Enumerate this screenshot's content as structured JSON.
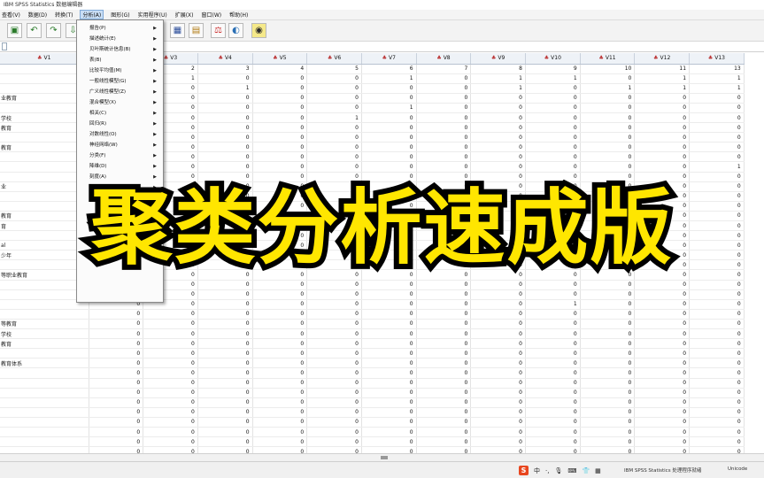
{
  "window": {
    "title": "IBM SPSS Statistics 数据编辑器"
  },
  "menubar": {
    "items": [
      "查看(V)",
      "数据(D)",
      "转换(T)",
      "分析(A)",
      "图形(G)",
      "实用程序(U)",
      "扩展(X)",
      "窗口(W)",
      "帮助(H)"
    ],
    "active": "分析(A)"
  },
  "analyze_menu": {
    "items": [
      {
        "label": "报告(P)",
        "submenu": true
      },
      {
        "label": "描述统计(E)",
        "submenu": true
      },
      {
        "label": "贝叶斯统计信息(B)",
        "submenu": true
      },
      {
        "label": "表(B)",
        "submenu": true
      },
      {
        "label": "比较平均值(M)",
        "submenu": true
      },
      {
        "label": "一般线性模型(G)",
        "submenu": true
      },
      {
        "label": "广义线性模型(Z)",
        "submenu": true
      },
      {
        "label": "混合模型(X)",
        "submenu": true
      },
      {
        "label": "相关(C)",
        "submenu": true
      },
      {
        "label": "回归(R)",
        "submenu": true
      },
      {
        "label": "对数线性(O)",
        "submenu": true
      },
      {
        "label": "神经网络(W)",
        "submenu": true
      },
      {
        "label": "分类(F)",
        "submenu": true
      },
      {
        "label": "降维(D)",
        "submenu": true
      },
      {
        "label": "刻度(A)",
        "submenu": true
      },
      {
        "label": "直销(K)",
        "submenu": true
      }
    ]
  },
  "grid": {
    "columns": [
      "V1",
      "V2",
      "V3",
      "V4",
      "V5",
      "V6",
      "V7",
      "V8",
      "V9",
      "V10",
      "V11",
      "V12",
      "V13"
    ],
    "rows": [
      [
        "",
        "",
        "2",
        "3",
        "4",
        "5",
        "6",
        "7",
        "8",
        "9",
        "10",
        "11",
        "13"
      ],
      [
        "",
        "",
        "1",
        "0",
        "0",
        "0",
        "1",
        "0",
        "1",
        "1",
        "0",
        "1",
        "1"
      ],
      [
        "",
        "",
        "0",
        "1",
        "0",
        "0",
        "0",
        "0",
        "1",
        "0",
        "1",
        "1",
        "1"
      ],
      [
        "业教育",
        "",
        "0",
        "0",
        "0",
        "0",
        "0",
        "0",
        "0",
        "0",
        "0",
        "0",
        "0"
      ],
      [
        "",
        "",
        "0",
        "0",
        "0",
        "0",
        "1",
        "0",
        "0",
        "0",
        "0",
        "0",
        "0"
      ],
      [
        "学校",
        "",
        "0",
        "0",
        "0",
        "1",
        "0",
        "0",
        "0",
        "0",
        "0",
        "0",
        "0"
      ],
      [
        "教育",
        "",
        "0",
        "0",
        "0",
        "0",
        "0",
        "0",
        "0",
        "0",
        "0",
        "0",
        "0"
      ],
      [
        "",
        "",
        "0",
        "0",
        "0",
        "0",
        "0",
        "0",
        "0",
        "0",
        "0",
        "0",
        "0"
      ],
      [
        "教育",
        "",
        "0",
        "0",
        "0",
        "0",
        "0",
        "0",
        "0",
        "0",
        "0",
        "0",
        "0"
      ],
      [
        "",
        "",
        "0",
        "0",
        "0",
        "0",
        "0",
        "0",
        "0",
        "0",
        "0",
        "0",
        "0"
      ],
      [
        "",
        "",
        "0",
        "0",
        "0",
        "0",
        "0",
        "0",
        "0",
        "0",
        "0",
        "0",
        "1"
      ],
      [
        "",
        "",
        "0",
        "0",
        "0",
        "0",
        "0",
        "0",
        "0",
        "0",
        "0",
        "0",
        "0"
      ],
      [
        "业",
        "",
        "0",
        "0",
        "0",
        "0",
        "0",
        "0",
        "0",
        "0",
        "0",
        "0",
        "0"
      ],
      [
        "",
        "",
        "0",
        "0",
        "0",
        "0",
        "0",
        "0",
        "0",
        "0",
        "0",
        "0",
        "0"
      ],
      [
        "",
        "",
        "0",
        "0",
        "0",
        "0",
        "0",
        "0",
        "0",
        "0",
        "0",
        "0",
        "0"
      ],
      [
        "教育",
        "",
        "0",
        "0",
        "0",
        "0",
        "0",
        "0",
        "0",
        "0",
        "0",
        "0",
        "0"
      ],
      [
        "育",
        "",
        "0",
        "0",
        "0",
        "0",
        "0",
        "0",
        "0",
        "0",
        "0",
        "0",
        "0"
      ],
      [
        "",
        "",
        "0",
        "0",
        "0",
        "0",
        "0",
        "0",
        "0",
        "0",
        "0",
        "0",
        "0"
      ],
      [
        "al",
        "",
        "0",
        "0",
        "0",
        "0",
        "0",
        "0",
        "0",
        "0",
        "0",
        "0",
        "0"
      ],
      [
        "少年",
        "",
        "0",
        "0",
        "0",
        "0",
        "0",
        "0",
        "0",
        "0",
        "0",
        "0",
        "0"
      ],
      [
        "",
        "",
        "0",
        "0",
        "0",
        "0",
        "0",
        "0",
        "0",
        "0",
        "0",
        "0",
        "0"
      ],
      [
        "等职业教育",
        "",
        "0",
        "0",
        "0",
        "0",
        "0",
        "0",
        "0",
        "0",
        "0",
        "0",
        "0"
      ],
      [
        "",
        "",
        "0",
        "0",
        "0",
        "0",
        "0",
        "0",
        "0",
        "0",
        "0",
        "0",
        "0"
      ],
      [
        "",
        "0",
        "0",
        "0",
        "0",
        "0",
        "0",
        "0",
        "0",
        "0",
        "0",
        "0",
        "0"
      ],
      [
        "",
        "0",
        "0",
        "0",
        "0",
        "0",
        "0",
        "0",
        "0",
        "1",
        "0",
        "0",
        "0"
      ],
      [
        "",
        "0",
        "0",
        "0",
        "0",
        "0",
        "0",
        "0",
        "0",
        "0",
        "0",
        "0",
        "0"
      ],
      [
        "等教育",
        "0",
        "0",
        "0",
        "0",
        "0",
        "0",
        "0",
        "0",
        "0",
        "0",
        "0",
        "0"
      ],
      [
        "学校",
        "0",
        "0",
        "0",
        "0",
        "0",
        "0",
        "0",
        "0",
        "0",
        "0",
        "0",
        "0"
      ],
      [
        "教育",
        "0",
        "0",
        "0",
        "0",
        "0",
        "0",
        "0",
        "0",
        "0",
        "0",
        "0",
        "0"
      ],
      [
        "",
        "0",
        "0",
        "0",
        "0",
        "0",
        "0",
        "0",
        "0",
        "0",
        "0",
        "0",
        "0"
      ],
      [
        "教育体系",
        "0",
        "0",
        "0",
        "0",
        "0",
        "0",
        "0",
        "0",
        "0",
        "0",
        "0",
        "0"
      ],
      [
        "",
        "0",
        "0",
        "0",
        "0",
        "0",
        "0",
        "0",
        "0",
        "0",
        "0",
        "0",
        "0"
      ],
      [
        "",
        "0",
        "0",
        "0",
        "0",
        "0",
        "0",
        "0",
        "0",
        "0",
        "0",
        "0",
        "0"
      ],
      [
        "",
        "0",
        "0",
        "0",
        "0",
        "0",
        "0",
        "0",
        "0",
        "0",
        "0",
        "0",
        "0"
      ],
      [
        "",
        "0",
        "0",
        "0",
        "0",
        "0",
        "0",
        "0",
        "0",
        "0",
        "0",
        "0",
        "0"
      ],
      [
        "",
        "0",
        "0",
        "0",
        "0",
        "0",
        "0",
        "0",
        "0",
        "0",
        "0",
        "0",
        "0"
      ],
      [
        "",
        "0",
        "0",
        "0",
        "0",
        "0",
        "0",
        "0",
        "0",
        "0",
        "0",
        "0",
        "0"
      ],
      [
        "",
        "0",
        "0",
        "0",
        "0",
        "0",
        "0",
        "0",
        "0",
        "0",
        "0",
        "0",
        "0"
      ],
      [
        "",
        "0",
        "0",
        "0",
        "0",
        "0",
        "0",
        "0",
        "0",
        "0",
        "0",
        "0",
        "0"
      ],
      [
        "",
        "0",
        "0",
        "0",
        "0",
        "0",
        "0",
        "0",
        "0",
        "0",
        "0",
        "0",
        "0"
      ]
    ]
  },
  "overlay": {
    "text": "聚类分析速成版",
    "color": "#ffe600"
  },
  "statusbar": {
    "ime_icons": [
      "S",
      "中",
      "·,",
      "mic-icon",
      "keyboard-icon",
      "shirt-icon",
      "grid-icon"
    ],
    "ime_text": [
      "S",
      "中",
      "·,"
    ],
    "message": "IBM SPSS Statistics 处理程序就绪",
    "encoding": "Unicode"
  }
}
